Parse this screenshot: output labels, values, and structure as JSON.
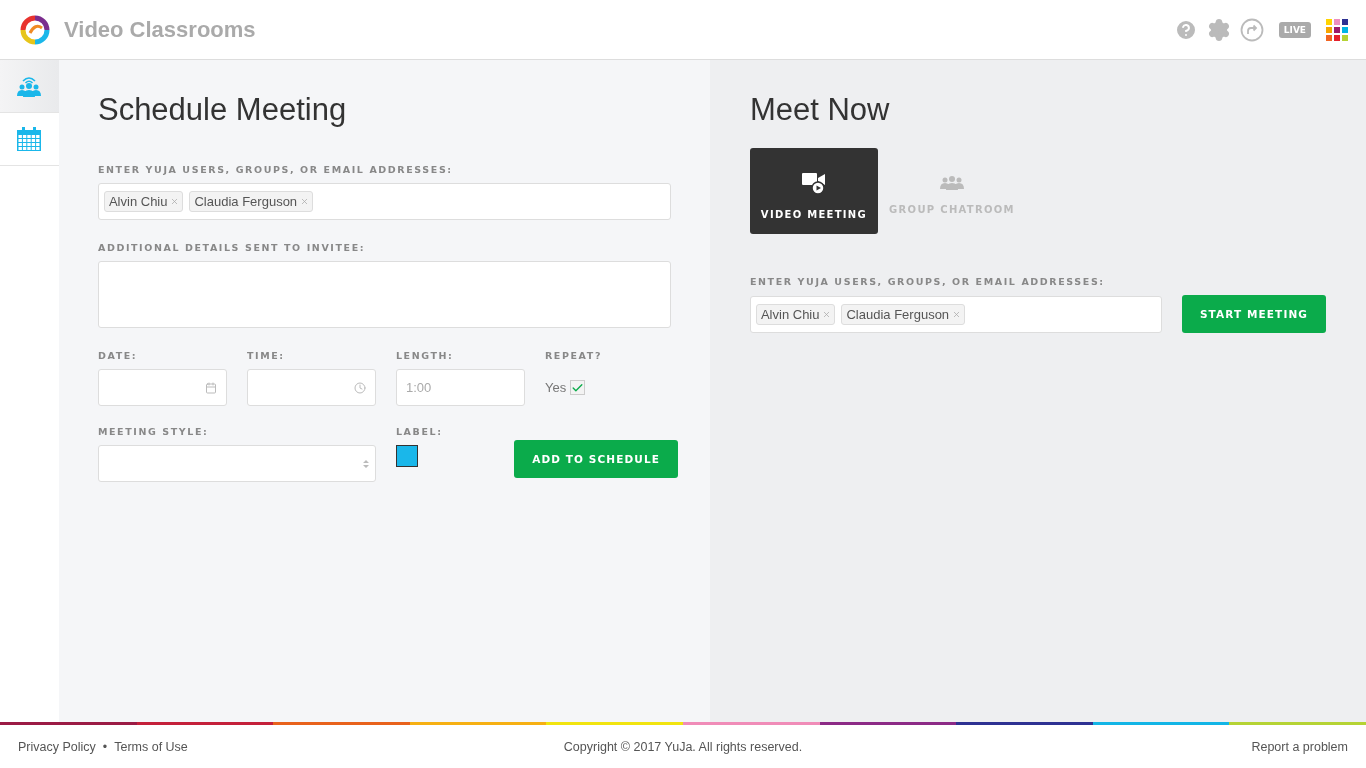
{
  "header": {
    "title": "Video Classrooms",
    "live_badge": "LIVE"
  },
  "sidebar": {
    "items": [
      {
        "kind": "meetings",
        "selected": true
      },
      {
        "kind": "calendar",
        "selected": false
      }
    ]
  },
  "schedule": {
    "title": "Schedule Meeting",
    "invitees_label": "ENTER YUJA USERS, GROUPS, OR EMAIL ADDRESSES:",
    "invitees": [
      "Alvin Chiu",
      "Claudia Ferguson"
    ],
    "details_label": "ADDITIONAL DETAILS SENT TO INVITEE:",
    "date_label": "DATE:",
    "time_label": "TIME:",
    "length_label": "LENGTH:",
    "length_placeholder": "1:00",
    "repeat_label": "REPEAT?",
    "repeat_text": "Yes",
    "repeat_checked": true,
    "style_label": "MEETING STYLE:",
    "label_label": "LABEL:",
    "label_swatch": {
      "color": "#1ab7ea"
    },
    "add_button": "ADD TO SCHEDULE"
  },
  "meet_now": {
    "title": "Meet Now",
    "tabs": [
      {
        "kind": "video",
        "label": "VIDEO MEETING",
        "selected": true
      },
      {
        "kind": "group",
        "label": "GROUP CHATROOM",
        "selected": false
      }
    ],
    "invitees_label": "ENTER YUJA USERS, GROUPS, OR EMAIL ADDRESSES:",
    "invitees": [
      "Alvin Chiu",
      "Claudia Ferguson"
    ],
    "start_button": "START MEETING"
  },
  "footer": {
    "privacy": "Privacy Policy",
    "separator": "•",
    "terms": "Terms of Use",
    "copyright": "Copyright © 2017 YuJa. All rights reserved.",
    "report": "Report a problem"
  }
}
